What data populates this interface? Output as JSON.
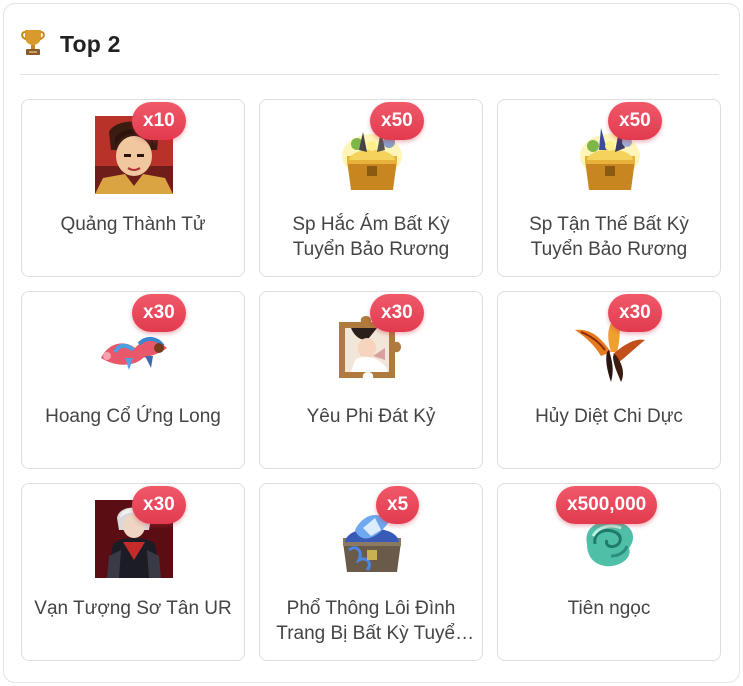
{
  "header": {
    "icon": "trophy-icon",
    "title": "Top 2"
  },
  "items": [
    {
      "name": "Quảng Thành Tử",
      "qty": "x10",
      "icon": "hero-portrait-icon"
    },
    {
      "name": "Sp Hắc Ám Bất Kỳ Tuyển Bảo Rương",
      "qty": "x50",
      "icon": "treasure-chest-icon"
    },
    {
      "name": "Sp Tận Thế Bất Kỳ Tuyển Bảo Rương",
      "qty": "x50",
      "icon": "treasure-chest-icon"
    },
    {
      "name": "Hoang Cổ Ứng Long",
      "qty": "x30",
      "icon": "dragon-icon"
    },
    {
      "name": "Yêu Phi Đát Kỷ",
      "qty": "x30",
      "icon": "puzzle-piece-icon"
    },
    {
      "name": "Hủy Diệt Chi Dực",
      "qty": "x30",
      "icon": "wings-icon"
    },
    {
      "name": "Vạn Tượng Sơ Tân UR",
      "qty": "x30",
      "icon": "warrior-portrait-icon"
    },
    {
      "name": "Phổ Thông Lôi Đình Trang Bị Bất Kỳ Tuyển Bảo Rương",
      "qty": "x5",
      "icon": "blue-chest-icon"
    },
    {
      "name": "Tiên ngọc",
      "qty": "x500,000",
      "icon": "jade-gem-icon"
    }
  ],
  "colors": {
    "badge": "#e84457",
    "border": "#dedede"
  }
}
